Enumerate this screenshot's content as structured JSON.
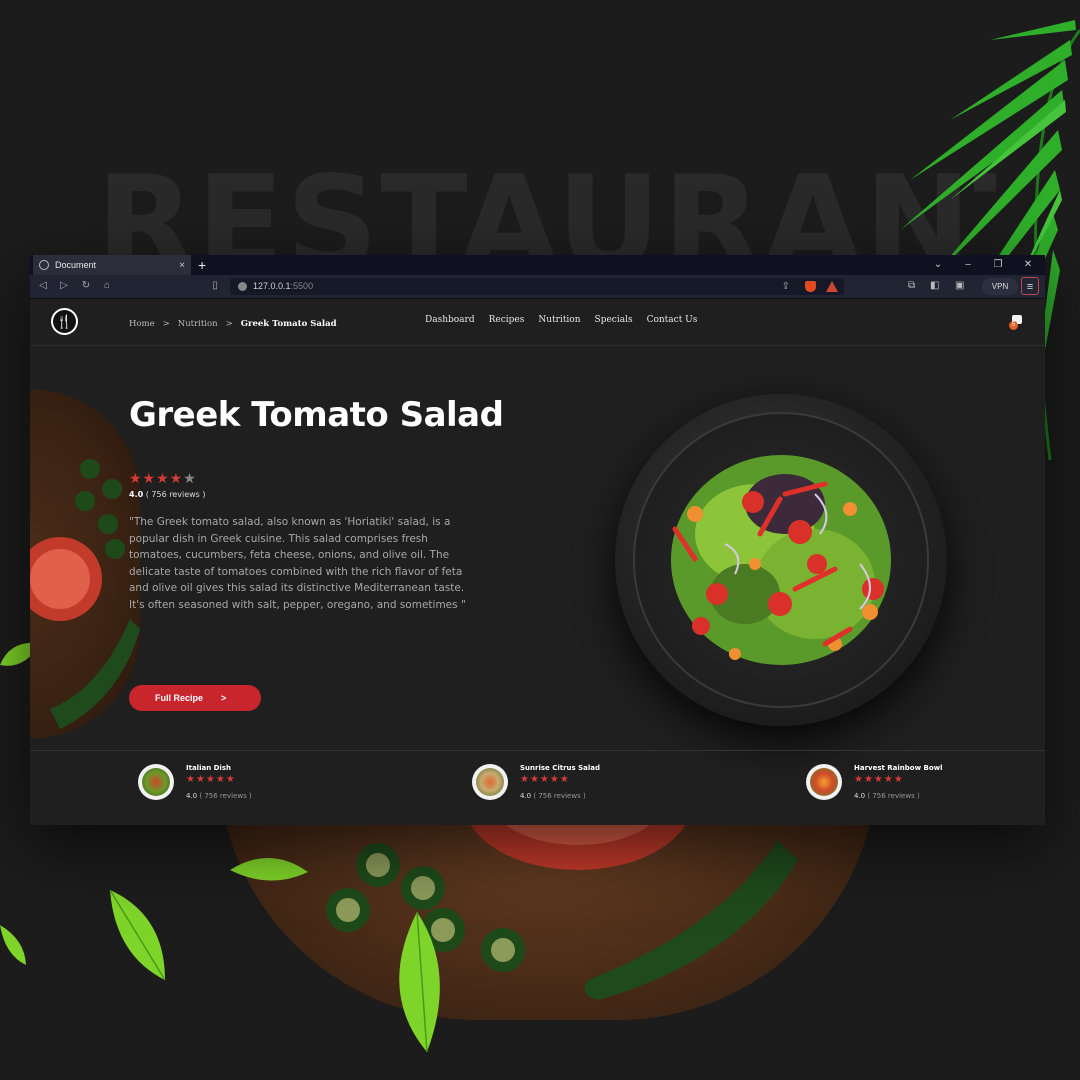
{
  "background": {
    "word": "RESTAURANT"
  },
  "browser": {
    "tab_title": "Document",
    "close_glyph": "×",
    "new_tab_glyph": "+",
    "url_host": "127.0.0.1",
    "url_port": ":5500",
    "vpn_label": "VPN",
    "window_controls": [
      "⌄",
      "–",
      "❐",
      "✕"
    ]
  },
  "site": {
    "nav": [
      "Dashboard",
      "Recipes",
      "Nutrition",
      "Specials",
      "Contact Us"
    ],
    "cart_count": "5",
    "breadcrumb": {
      "home": "Home",
      "sep": ">",
      "section": "Nutrition",
      "current": "Greek Tomato Salad"
    },
    "title": "Greek Tomato Salad",
    "rating": {
      "value": "4.0",
      "reviews": "( 756 reviews )",
      "stars_filled": 4,
      "stars_total": 5
    },
    "description": "\"The Greek tomato salad, also known as 'Horiatiki' salad, is a popular dish in Greek cuisine. This salad comprises fresh tomatoes, cucumbers, feta cheese, onions, and olive oil. The delicate taste of tomatoes combined with the rich flavor of feta and olive oil gives this salad its distinctive Mediterranean taste. It's often seasoned with salt, pepper, oregano, and sometimes \"",
    "cta": {
      "label": "Full Recipe",
      "arrow": ">"
    },
    "related": [
      {
        "name": "Italian Dish",
        "rating": "4.0",
        "reviews": "( 756 reviews )"
      },
      {
        "name": "Sunrise Citrus Salad",
        "rating": "4.0",
        "reviews": "( 756 reviews )"
      },
      {
        "name": "Harvest Rainbow Bowl",
        "rating": "4.0",
        "reviews": "( 756 reviews )"
      }
    ]
  },
  "colors": {
    "accent": "#c8262c",
    "star": "#d43a36",
    "page_bg": "#1f1f1f",
    "badge": "#e0602a"
  }
}
